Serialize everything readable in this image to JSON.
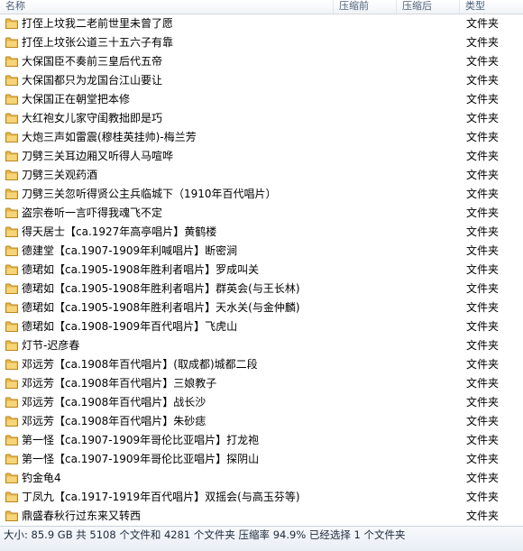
{
  "columns": {
    "name": "名称",
    "size_before": "压缩前",
    "size_after": "压缩后",
    "type": "类型"
  },
  "folder_icon": "folder-icon",
  "folder_color": "#e8b84a",
  "rows": [
    {
      "name": "打侄上坟我二老前世里未曾了愿",
      "type": "文件夹"
    },
    {
      "name": "打侄上坟张公道三十五六子有靠",
      "type": "文件夹"
    },
    {
      "name": "大保国臣不奏前三皇后代五帝",
      "type": "文件夹"
    },
    {
      "name": "大保国都只为龙国台江山要让",
      "type": "文件夹"
    },
    {
      "name": "大保国正在朝堂把本修",
      "type": "文件夹"
    },
    {
      "name": "大红袍女儿家守闺教拙即是巧",
      "type": "文件夹"
    },
    {
      "name": "大炮三声如雷震(穆桂英挂帅)-梅兰芳",
      "type": "文件夹"
    },
    {
      "name": "刀劈三关耳边厢又听得人马喧哗",
      "type": "文件夹"
    },
    {
      "name": "刀劈三关观药酒",
      "type": "文件夹"
    },
    {
      "name": "刀劈三关忽听得贤公主兵临城下（1910年百代唱片）",
      "type": "文件夹"
    },
    {
      "name": "盗宗卷听一言吓得我魂飞不定",
      "type": "文件夹"
    },
    {
      "name": "得天居士【ca.1927年高亭唱片】黄鹤楼",
      "type": "文件夹"
    },
    {
      "name": "德建堂【ca.1907-1909年利喊唱片】断密涧",
      "type": "文件夹"
    },
    {
      "name": "德珺如【ca.1905-1908年胜利者唱片】罗成叫关",
      "type": "文件夹"
    },
    {
      "name": "德珺如【ca.1905-1908年胜利者唱片】群英会(与王长林)",
      "type": "文件夹"
    },
    {
      "name": "德珺如【ca.1905-1908年胜利者唱片】天水关(与金仲麟)",
      "type": "文件夹"
    },
    {
      "name": "德珺如【ca.1908-1909年百代唱片】飞虎山",
      "type": "文件夹"
    },
    {
      "name": "灯节-迟彦春",
      "type": "文件夹"
    },
    {
      "name": "邓远芳【ca.1908年百代唱片】(取成都)城都二段",
      "type": "文件夹"
    },
    {
      "name": "邓远芳【ca.1908年百代唱片】三娘教子",
      "type": "文件夹"
    },
    {
      "name": "邓远芳【ca.1908年百代唱片】战长沙",
      "type": "文件夹"
    },
    {
      "name": "邓远芳【ca.1908年百代唱片】朱砂痣",
      "type": "文件夹"
    },
    {
      "name": "第一怪【ca.1907-1909年哥伦比亚唱片】打龙袍",
      "type": "文件夹"
    },
    {
      "name": "第一怪【ca.1907-1909年哥伦比亚唱片】探阴山",
      "type": "文件夹"
    },
    {
      "name": "钓金龟4",
      "type": "文件夹"
    },
    {
      "name": "丁凤九【ca.1917-1919年百代唱片】双摇会(与高玉芬等)",
      "type": "文件夹"
    },
    {
      "name": "鼎盛春秋行过东来又转西",
      "type": "文件夹"
    }
  ],
  "status": {
    "text": "大小: 85.9 GB 共 5108 个文件和 4281 个文件夹 压缩率 94.9% 已经选择 1 个文件夹"
  }
}
